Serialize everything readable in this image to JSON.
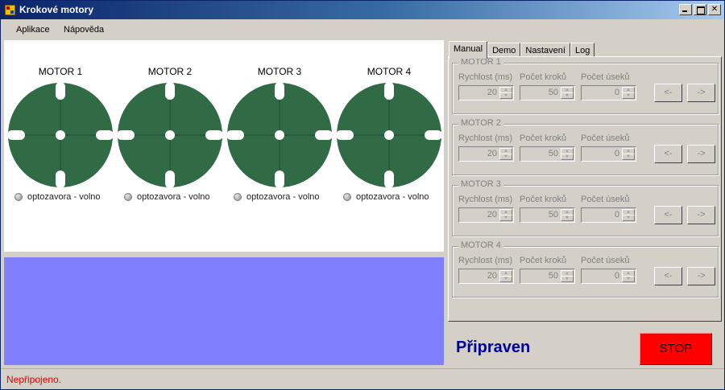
{
  "window": {
    "title": "Krokové motory"
  },
  "menu": {
    "items": [
      "Aplikace",
      "Nápověda"
    ]
  },
  "motors": [
    {
      "title": "MOTOR 1",
      "sensor_label": "optozavora - volno"
    },
    {
      "title": "MOTOR 2",
      "sensor_label": "optozavora - volno"
    },
    {
      "title": "MOTOR 3",
      "sensor_label": "optozavora - volno"
    },
    {
      "title": "MOTOR 4",
      "sensor_label": "optozavora - volno"
    }
  ],
  "tabs": [
    "Manual",
    "Demo",
    "Nastavení",
    "Log"
  ],
  "active_tab": "Manual",
  "motor_controls": [
    {
      "title": "MOTOR 1",
      "speed_label": "Rychlost (ms)",
      "steps_label": "Počet kroků",
      "segments_label": "Počet úseků",
      "speed": "20",
      "steps": "50",
      "segments": "0",
      "left_button": "<-",
      "right_button": "->"
    },
    {
      "title": "MOTOR 2",
      "speed_label": "Rychlost (ms)",
      "steps_label": "Počet kroků",
      "segments_label": "Počet úseků",
      "speed": "20",
      "steps": "50",
      "segments": "0",
      "left_button": "<-",
      "right_button": "->"
    },
    {
      "title": "MOTOR 3",
      "speed_label": "Rychlost (ms)",
      "steps_label": "Počet kroků",
      "segments_label": "Počet úseků",
      "speed": "20",
      "steps": "50",
      "segments": "0",
      "left_button": "<-",
      "right_button": "->"
    },
    {
      "title": "MOTOR 4",
      "speed_label": "Rychlost (ms)",
      "steps_label": "Počet kroků",
      "segments_label": "Počet úseků",
      "speed": "20",
      "steps": "50",
      "segments": "0",
      "left_button": "<-",
      "right_button": "->"
    }
  ],
  "status": {
    "ready_text": "Připraven",
    "stop_label": "STOP",
    "connection": "Nepřipojeno."
  },
  "colors": {
    "wheel": "#316b46",
    "log_area": "#8080ff",
    "stop_button": "#ff0000",
    "ready_text": "#0000a0",
    "status_text": "#e00000"
  },
  "icons": {
    "app": "app-icon",
    "minimize": "minimize-icon",
    "maximize": "maximize-icon",
    "close": "close-icon",
    "sensor": "led-icon"
  }
}
